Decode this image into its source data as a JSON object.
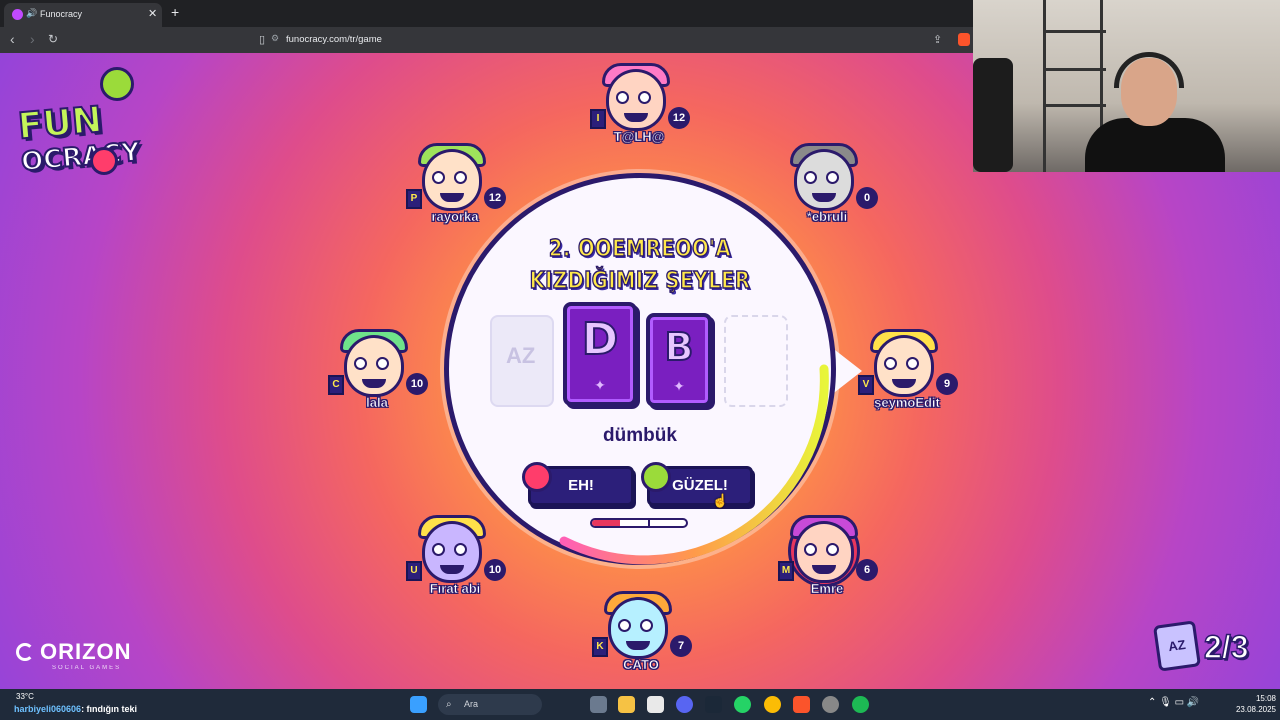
{
  "browser": {
    "tab_title": "Funocracy",
    "url": "funocracy.com/tr/game"
  },
  "logo": {
    "word_a": "FUN",
    "word_b": "OCRACY"
  },
  "publisher": {
    "name": "ORIZON",
    "tagline": "SOCIAL GAMES"
  },
  "prompt": {
    "line1": "2. OOEMREOO'A",
    "line2": "KIZDIĞIMIZ ŞEYLER"
  },
  "cards": [
    {
      "letter": "D"
    },
    {
      "letter": "B"
    }
  ],
  "card_ghost_label": "AZ",
  "answer": "dümbük",
  "buttons": {
    "meh": "EH!",
    "good": "GÜZEL!"
  },
  "vote_meter": {
    "fill_fraction": 0.3
  },
  "round": {
    "text": "2/3",
    "icon_label": "AZ"
  },
  "players": [
    {
      "name": "T@LH@",
      "score": "12",
      "letter": "I",
      "hair": "#ff7ac6",
      "skin": "#ffd4c2",
      "id": "talha"
    },
    {
      "name": "rayorka",
      "score": "12",
      "letter": "P",
      "hair": "#9ee35b",
      "skin": "#ffe1c8",
      "id": "rayorka"
    },
    {
      "name": "*ebruli",
      "score": "0",
      "letter": "",
      "hair": "#8a8a8a",
      "skin": "#dcdcdc",
      "id": "ebruli"
    },
    {
      "name": "lala",
      "score": "10",
      "letter": "C",
      "hair": "#6fe38a",
      "skin": "#ffe1c8",
      "id": "lala"
    },
    {
      "name": "şeymoEdit",
      "score": "9",
      "letter": "V",
      "hair": "#ffe14a",
      "skin": "#ffe1c8",
      "id": "seymo"
    },
    {
      "name": "Fırat abi",
      "score": "10",
      "letter": "U",
      "hair": "#ffe14a",
      "skin": "#c9b6ff",
      "id": "firat"
    },
    {
      "name": "Emre",
      "score": "6",
      "letter": "M",
      "hair": "#c84ad8",
      "skin": "#ffd4c2",
      "id": "emre"
    },
    {
      "name": "CATO",
      "score": "7",
      "letter": "K",
      "hair": "#ffa93a",
      "skin": "#b6f0ff",
      "id": "cato"
    }
  ],
  "taskbar": {
    "weather": "33°C",
    "chat_user": "harbiyeli060606",
    "chat_msg": ": fındığın teki",
    "search_placeholder": "Ara",
    "time": "15:08",
    "date": "23.08.2025"
  },
  "colors": {
    "accent_yellow": "#ffe94a",
    "navy": "#2b1a6b",
    "card_purple": "#7a1fc0",
    "angry_red": "#ff3d6b",
    "thumb_green": "#9bdb3a"
  }
}
